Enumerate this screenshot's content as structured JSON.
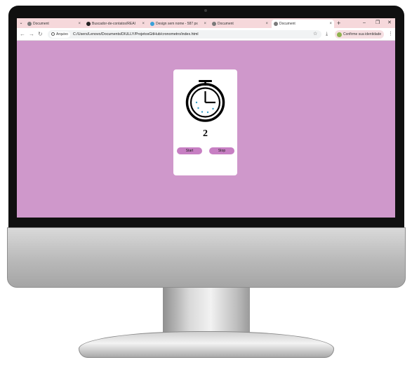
{
  "browser": {
    "tabs": [
      {
        "label": "Document",
        "active": false
      },
      {
        "label": "Buscador-de-contatos/REAI",
        "active": false
      },
      {
        "label": "Design sem nome - 587 px",
        "active": false
      },
      {
        "label": "Document",
        "active": false
      },
      {
        "label": "Document",
        "active": true
      }
    ],
    "site_chip": "Arquivo",
    "url": "C:/Users/Lenovo/Documents/DIULLY/ProjetosGitHub/cronometro/index.html",
    "identity_label": "Confirme sua identidade"
  },
  "page": {
    "background": "#cf98cb",
    "counter": "2",
    "start_label": "Start",
    "stop_label": "Stop",
    "button_color": "#c77fc3",
    "icon": "stopwatch-icon"
  }
}
